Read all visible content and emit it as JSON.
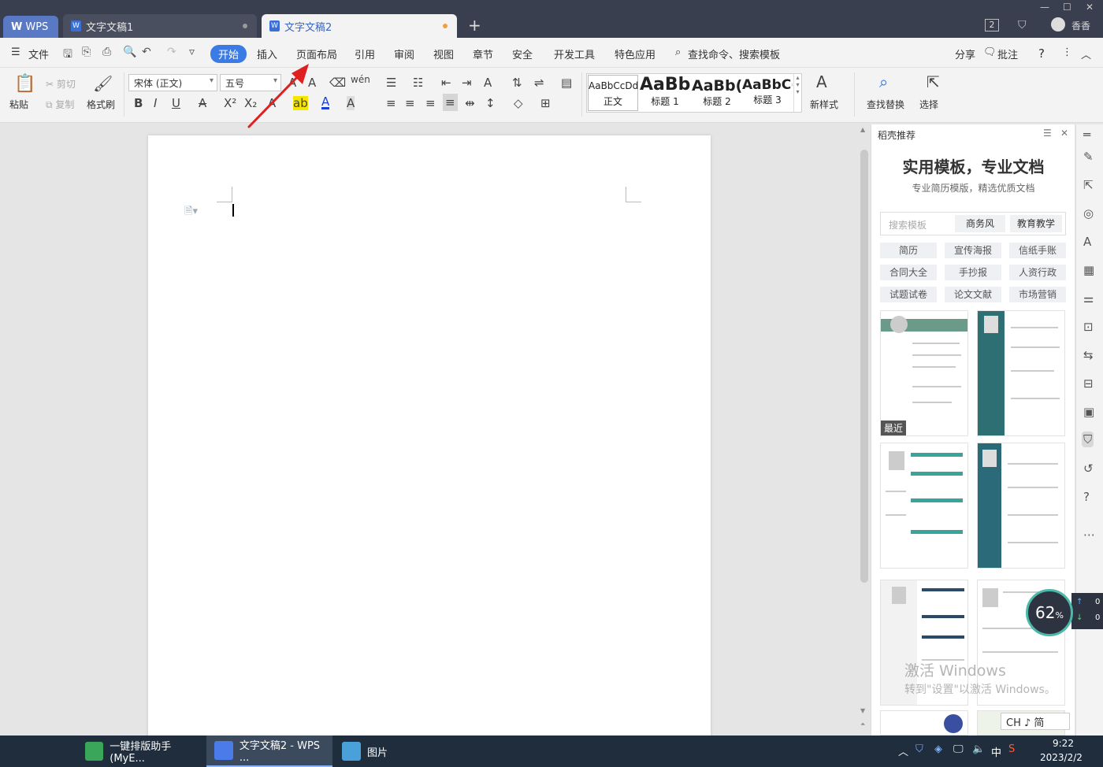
{
  "titlebar": {
    "tabs": [
      {
        "label": "WPS"
      },
      {
        "label": "文字文稿1"
      },
      {
        "label": "文字文稿2"
      }
    ],
    "new_tab": "+",
    "badge": "2",
    "user": "香香"
  },
  "menubar": {
    "file": "文件",
    "items": [
      "开始",
      "插入",
      "页面布局",
      "引用",
      "审阅",
      "视图",
      "章节",
      "安全",
      "开发工具",
      "特色应用"
    ],
    "search": "查找命令、搜索模板",
    "share": "分享",
    "comment": "批注"
  },
  "ribbon": {
    "paste": "粘贴",
    "cut": "剪切",
    "copy": "复制",
    "format_painter": "格式刷",
    "font_name": "宋体 (正文)",
    "font_size": "五号",
    "styles": [
      {
        "preview": "AaBbCcDd",
        "label": "正文"
      },
      {
        "preview": "AaBb",
        "label": "标题 1"
      },
      {
        "preview": "AaBb(",
        "label": "标题 2"
      },
      {
        "preview": "AaBbC(",
        "label": "标题 3"
      }
    ],
    "new_style": "新样式",
    "find_replace": "查找替换",
    "select": "选择"
  },
  "panel": {
    "header": "稻壳推荐",
    "title": "实用模板，专业文档",
    "subtitle": "专业简历模版，精选优质文档",
    "search_placeholder": "搜索模板",
    "search_tags": [
      "商务风",
      "教育教学"
    ],
    "tags": [
      "简历",
      "宣传海报",
      "信纸手账",
      "合同大全",
      "手抄报",
      "人资行政",
      "试题试卷",
      "论文文献",
      "市场营销"
    ],
    "recent_badge": "最近"
  },
  "overlay": {
    "gauge": "62",
    "gauge_unit": "%",
    "net_up": "0",
    "net_down": "0",
    "watermark_line1": "激活 Windows",
    "watermark_line2": "转到\"设置\"以激活 Windows。",
    "ime": "CH ♪ 简"
  },
  "taskbar": {
    "items": [
      {
        "label": "一键排版助手(MyE..."
      },
      {
        "label": "文字文稿2 - WPS ..."
      },
      {
        "label": "图片"
      }
    ],
    "ime_state": "中",
    "time": "9:22",
    "date": "2023/2/2"
  },
  "colors": {
    "titlebar": "#3a3f4f",
    "accent": "#3b7be6",
    "arrow": "#e02020",
    "taskbar": "#1f2d3d"
  }
}
